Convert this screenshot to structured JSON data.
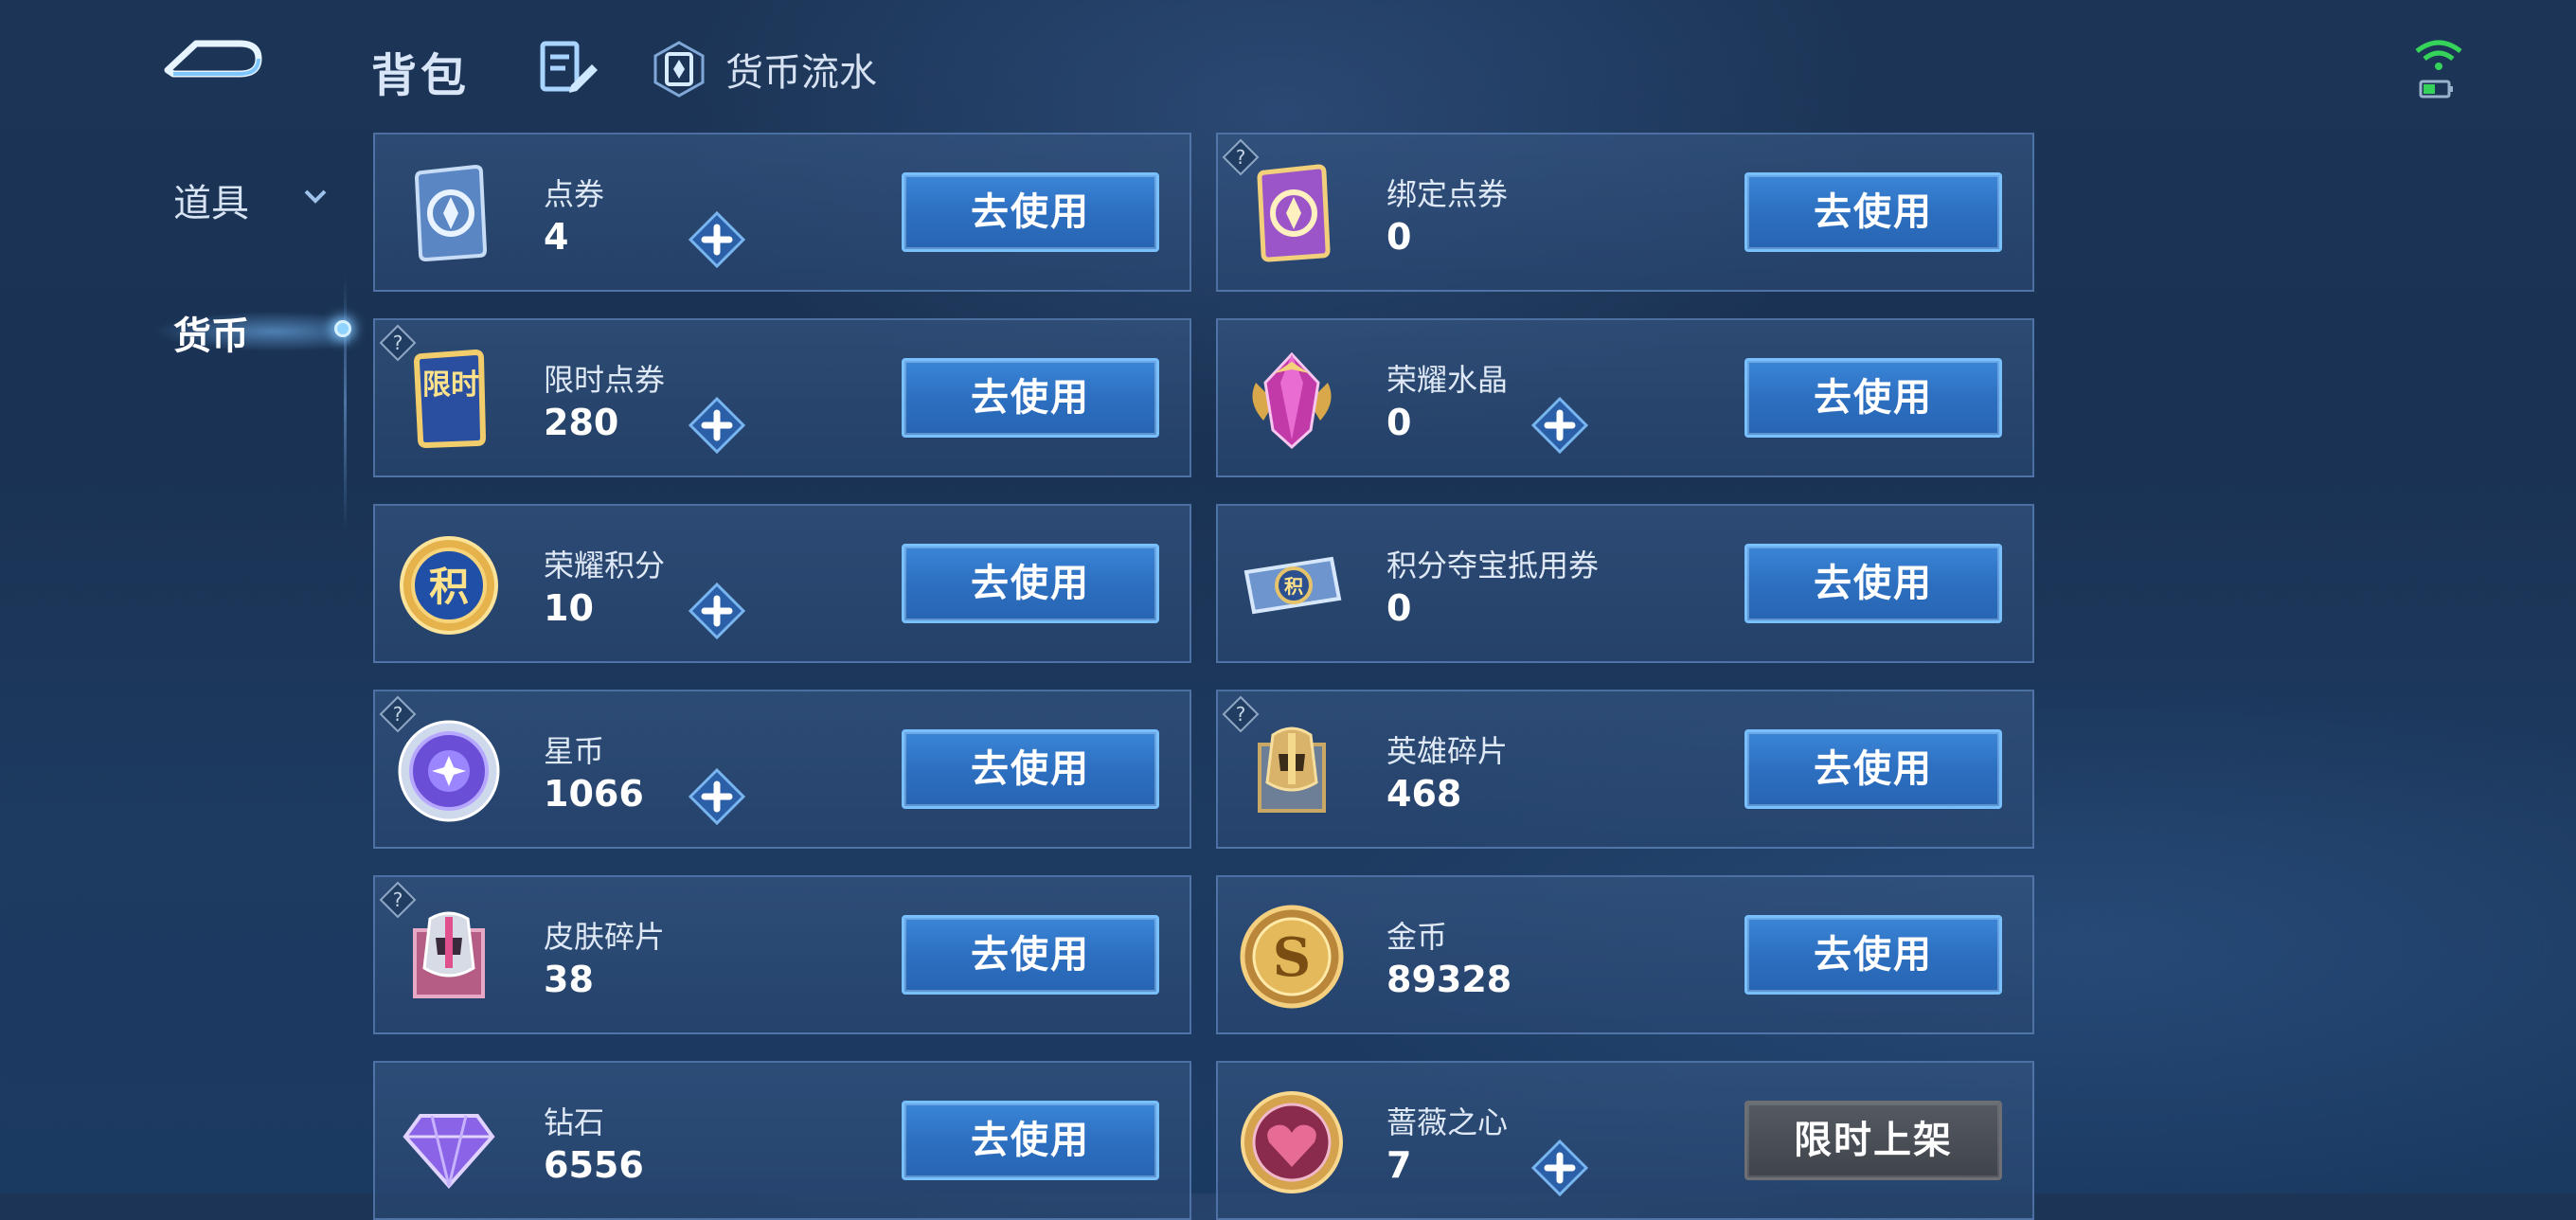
{
  "header": {
    "title": "背包",
    "flow_label": "货币流水"
  },
  "sidebar": {
    "items": [
      {
        "label": "道具"
      },
      {
        "label": "货币"
      }
    ]
  },
  "currencies": [
    {
      "name": "点券",
      "value": "4",
      "button": "去使用"
    },
    {
      "name": "绑定点券",
      "value": "0",
      "button": "去使用"
    },
    {
      "name": "限时点券",
      "value": "280",
      "button": "去使用"
    },
    {
      "name": "荣耀水晶",
      "value": "0",
      "button": "去使用"
    },
    {
      "name": "荣耀积分",
      "value": "10",
      "button": "去使用"
    },
    {
      "name": "积分夺宝抵用券",
      "value": "0",
      "button": "去使用"
    },
    {
      "name": "星币",
      "value": "1066",
      "button": "去使用"
    },
    {
      "name": "英雄碎片",
      "value": "468",
      "button": "去使用"
    },
    {
      "name": "皮肤碎片",
      "value": "38",
      "button": "去使用"
    },
    {
      "name": "金币",
      "value": "89328",
      "button": "去使用"
    },
    {
      "name": "钻石",
      "value": "6556",
      "button": "去使用"
    },
    {
      "name": "蔷薇之心",
      "value": "7",
      "button": "限时上架"
    }
  ],
  "icon_glyphs": {
    "limited_coupon": "限时",
    "honor_points": "积",
    "points_voucher": "积",
    "gold": "S"
  },
  "icon_names": [
    "coupon-icon",
    "bound-coupon-icon",
    "limited-coupon-icon",
    "honor-crystal-icon",
    "honor-points-icon",
    "points-voucher-icon",
    "star-coin-icon",
    "hero-fragment-icon",
    "skin-fragment-icon",
    "gold-coin-icon",
    "diamond-icon",
    "rose-heart-icon"
  ],
  "colors": {
    "button_blue": "#2d6fc0",
    "button_border": "#79c0ff",
    "button_disabled": "#4a4f56",
    "wifi_green": "#35d35a"
  }
}
